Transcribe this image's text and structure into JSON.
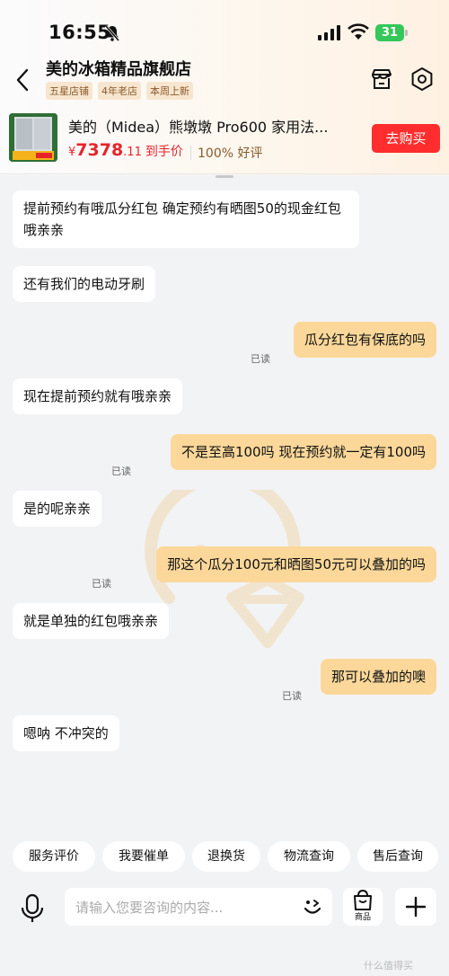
{
  "status_bar": {
    "time": "16:55",
    "battery": "31"
  },
  "header": {
    "shop_name": "美的冰箱精品旗舰店",
    "badges": [
      "五星店铺",
      "4年老店",
      "本周上新"
    ]
  },
  "product": {
    "title": "美的（Midea）熊墩墩 Pro600 家用法...",
    "price_symbol": "¥",
    "price_main": "7378",
    "price_decimal": ".11",
    "price_tag": "到手价",
    "rating": "100% 好评",
    "buy_label": "去购买"
  },
  "messages": [
    {
      "side": "left",
      "text": "提前预约有哦瓜分红包  确定预约有晒图50的现金红包哦亲亲"
    },
    {
      "side": "left",
      "text": "还有我们的电动牙刷"
    },
    {
      "side": "right",
      "text": "瓜分红包有保底的吗",
      "status": "已读"
    },
    {
      "side": "left",
      "text": "现在提前预约就有哦亲亲"
    },
    {
      "side": "right",
      "text": "不是至高100吗 现在预约就一定有100吗",
      "status": "已读"
    },
    {
      "side": "left",
      "text": "是的呢亲亲"
    },
    {
      "side": "right",
      "text": "那这个瓜分100元和晒图50元可以叠加的吗",
      "status": "已读"
    },
    {
      "side": "left",
      "text": "就是单独的红包哦亲亲"
    },
    {
      "side": "right",
      "text": "那可以叠加的噢",
      "status": "已读"
    },
    {
      "side": "left",
      "text": "嗯呐 不冲突的"
    }
  ],
  "quick_actions": [
    "服务评价",
    "我要催单",
    "退换货",
    "物流查询",
    "售后查询"
  ],
  "input": {
    "placeholder": "请输入您要咨询的内容...",
    "goods_label": "商品"
  },
  "watermark_text": "什么值得买",
  "colors": {
    "accent_red": "#ff2d2d",
    "price_red": "#e5252a",
    "my_bubble": "#fbd89a",
    "badge_bg": "#f7e6cf"
  }
}
